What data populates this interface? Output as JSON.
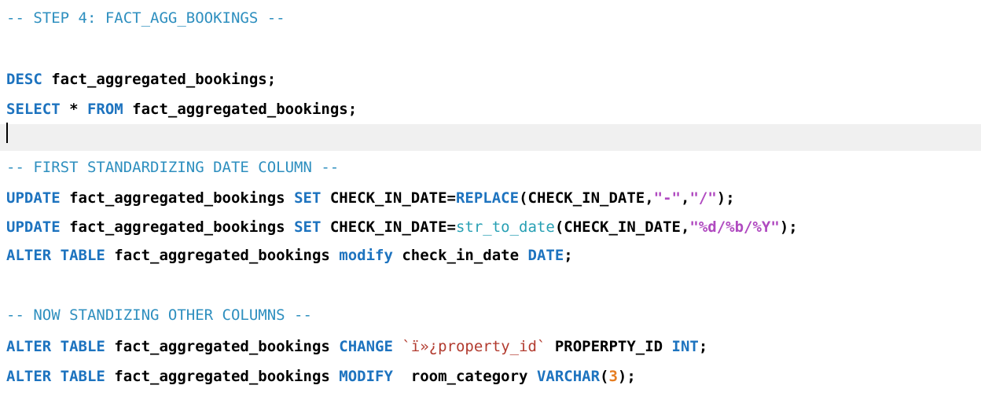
{
  "colors": {
    "comment": "#2e8fbf",
    "keyword": "#1d73bf",
    "function": "#28a0b4",
    "string": "#b04ac0",
    "number": "#e67e22",
    "quoted_identifier": "#b23b2f",
    "current_line_bg": "#f0f0f0"
  },
  "lines": [
    {
      "tokens": [
        {
          "type": "comment",
          "text": "-- STEP 4: FACT_AGG_BOOKINGS --"
        }
      ]
    },
    {
      "tokens": []
    },
    {
      "tokens": [
        {
          "type": "kw",
          "text": "DESC"
        },
        {
          "type": "plain",
          "text": " fact_aggregated_bookings;"
        }
      ]
    },
    {
      "tokens": [
        {
          "type": "kw",
          "text": "SELECT"
        },
        {
          "type": "plain",
          "text": " * "
        },
        {
          "type": "kw",
          "text": "FROM"
        },
        {
          "type": "plain",
          "text": " fact_aggregated_bookings;"
        }
      ]
    },
    {
      "tokens": [],
      "current": true
    },
    {
      "tokens": [
        {
          "type": "comment",
          "text": "-- FIRST STANDARDIZING DATE COLUMN --"
        }
      ]
    },
    {
      "tokens": [
        {
          "type": "kw",
          "text": "UPDATE"
        },
        {
          "type": "plain",
          "text": " fact_aggregated_bookings "
        },
        {
          "type": "kw",
          "text": "SET"
        },
        {
          "type": "plain",
          "text": " CHECK_IN_DATE="
        },
        {
          "type": "kw",
          "text": "REPLACE"
        },
        {
          "type": "plain",
          "text": "(CHECK_IN_DATE,"
        },
        {
          "type": "str",
          "text": "\"-\""
        },
        {
          "type": "plain",
          "text": ","
        },
        {
          "type": "str",
          "text": "\"/\""
        },
        {
          "type": "plain",
          "text": ");"
        }
      ]
    },
    {
      "tokens": [
        {
          "type": "kw",
          "text": "UPDATE"
        },
        {
          "type": "plain",
          "text": " fact_aggregated_bookings "
        },
        {
          "type": "kw",
          "text": "SET"
        },
        {
          "type": "plain",
          "text": " CHECK_IN_DATE="
        },
        {
          "type": "fn",
          "text": "str_to_date"
        },
        {
          "type": "plain",
          "text": "(CHECK_IN_DATE,"
        },
        {
          "type": "str",
          "text": "\"%d/%b/%Y\""
        },
        {
          "type": "plain",
          "text": ");"
        }
      ]
    },
    {
      "tokens": [
        {
          "type": "kw",
          "text": "ALTER TABLE"
        },
        {
          "type": "plain",
          "text": " fact_aggregated_bookings "
        },
        {
          "type": "kw",
          "text": "modify"
        },
        {
          "type": "plain",
          "text": " check_in_date "
        },
        {
          "type": "kw",
          "text": "DATE"
        },
        {
          "type": "plain",
          "text": ";"
        }
      ]
    },
    {
      "tokens": []
    },
    {
      "tokens": [
        {
          "type": "comment",
          "text": "-- NOW STANDIZING OTHER COLUMNS --"
        }
      ]
    },
    {
      "tokens": [
        {
          "type": "kw",
          "text": "ALTER TABLE"
        },
        {
          "type": "plain",
          "text": " fact_aggregated_bookings "
        },
        {
          "type": "kw",
          "text": "CHANGE"
        },
        {
          "type": "plain",
          "text": " "
        },
        {
          "type": "ident",
          "text": "`ï»¿property_id`"
        },
        {
          "type": "plain",
          "text": " PROPERPTY_ID "
        },
        {
          "type": "kw",
          "text": "INT"
        },
        {
          "type": "plain",
          "text": ";"
        }
      ]
    },
    {
      "tokens": [
        {
          "type": "kw",
          "text": "ALTER TABLE"
        },
        {
          "type": "plain",
          "text": " fact_aggregated_bookings "
        },
        {
          "type": "kw",
          "text": "MODIFY"
        },
        {
          "type": "plain",
          "text": "  room_category "
        },
        {
          "type": "kw",
          "text": "VARCHAR"
        },
        {
          "type": "plain",
          "text": "("
        },
        {
          "type": "num",
          "text": "3"
        },
        {
          "type": "plain",
          "text": ");"
        }
      ]
    }
  ]
}
